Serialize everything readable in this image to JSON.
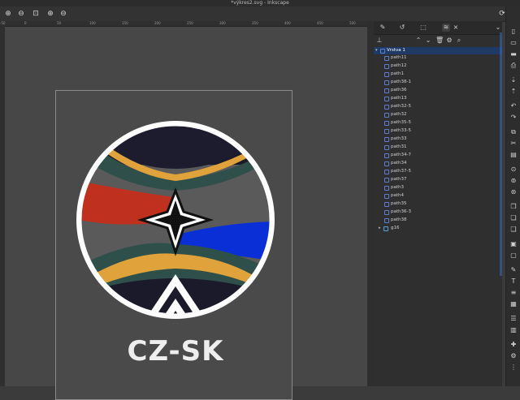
{
  "window": {
    "title": "*výkres2.svg - Inkscape"
  },
  "toolbar": {
    "zoom_in_icon": "⊕",
    "zoom_out_icon": "⊖",
    "fit_icon": "⊡"
  },
  "ruler": {
    "ticks": [
      "-50",
      "0",
      "50",
      "100",
      "150",
      "200",
      "250",
      "300",
      "350",
      "400",
      "450",
      "500"
    ]
  },
  "logo": {
    "text": "CZ-SK"
  },
  "panel": {
    "tabs": [
      "fill-stroke-icon",
      "undo-history-icon",
      "export-icon",
      "layers-objects-icon"
    ],
    "layers": [
      {
        "label": "Vrstva 1",
        "type": "layer",
        "selected": true
      },
      {
        "label": "path11"
      },
      {
        "label": "path12"
      },
      {
        "label": "path1"
      },
      {
        "label": "path38-1"
      },
      {
        "label": "path36"
      },
      {
        "label": "path13"
      },
      {
        "label": "path32-5"
      },
      {
        "label": "path32"
      },
      {
        "label": "path35-5"
      },
      {
        "label": "path33-5"
      },
      {
        "label": "path33"
      },
      {
        "label": "path31"
      },
      {
        "label": "path34-7"
      },
      {
        "label": "path34"
      },
      {
        "label": "path37-5"
      },
      {
        "label": "path37"
      },
      {
        "label": "path3"
      },
      {
        "label": "path4"
      },
      {
        "label": "path35"
      },
      {
        "label": "path36-3"
      },
      {
        "label": "path38"
      },
      {
        "label": "g16",
        "type": "group"
      }
    ]
  },
  "colors": {
    "accent": "#3b6fcf",
    "selection": "#203a66",
    "red": "#c0301e",
    "blue": "#0a2fd6",
    "orange": "#e0a23a",
    "teal": "#2f4f4a"
  }
}
